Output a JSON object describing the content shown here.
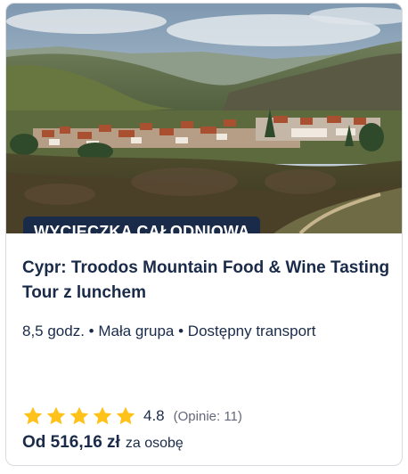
{
  "card": {
    "badge": "WYCIECZKA CAŁODNIOWA",
    "title": "Cypr: Troodos Mountain Food & Wine Tasting Tour z lunchem",
    "meta": "8,5 godz. • Mała grupa • Dostępny transport",
    "rating": {
      "value": "4.8",
      "stars": 5,
      "reviews": "(Opinie: 11)"
    },
    "price": {
      "amount": "Od 516,16 zł",
      "unit": "za osobę"
    }
  },
  "colors": {
    "brand_navy": "#1a2b49",
    "star": "#ffc21a",
    "muted_text": "#63687a"
  },
  "icons": [
    "star-icon"
  ]
}
